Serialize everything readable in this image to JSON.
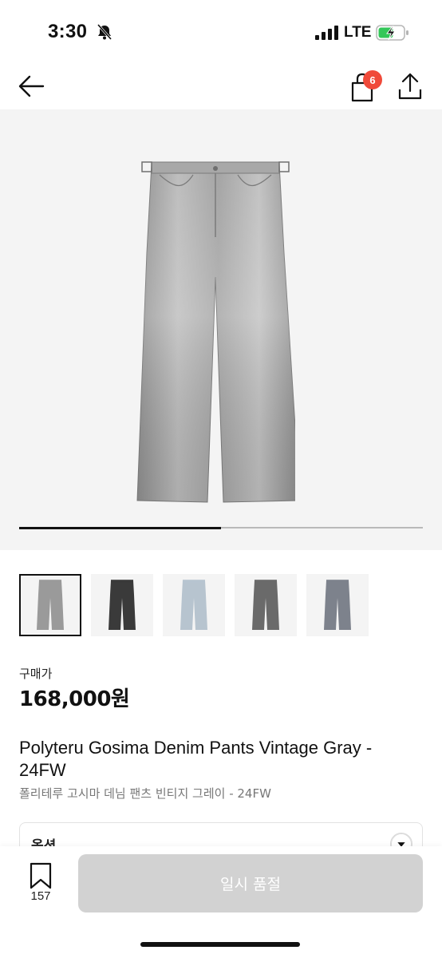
{
  "status_bar": {
    "time": "3:30",
    "network": "LTE"
  },
  "nav": {
    "cart_count": "6"
  },
  "gallery": {
    "progress": 0.5
  },
  "thumbnails": [
    {
      "color": "#9a9a9a"
    },
    {
      "color": "#3a3a3a"
    },
    {
      "color": "#b7c4cf"
    },
    {
      "color": "#6a6a6a"
    },
    {
      "color": "#7d828c"
    }
  ],
  "price": {
    "label": "구매가",
    "value": "168,000원"
  },
  "product": {
    "title": "Polyteru Gosima Denim Pants Vintage Gray - 24FW",
    "subtitle": "폴리테루 고시마 데님 팬츠 빈티지 그레이 - 24FW"
  },
  "option": {
    "label": "옵션"
  },
  "bottom": {
    "wish_count": "157",
    "soldout_label": "일시 품절"
  }
}
